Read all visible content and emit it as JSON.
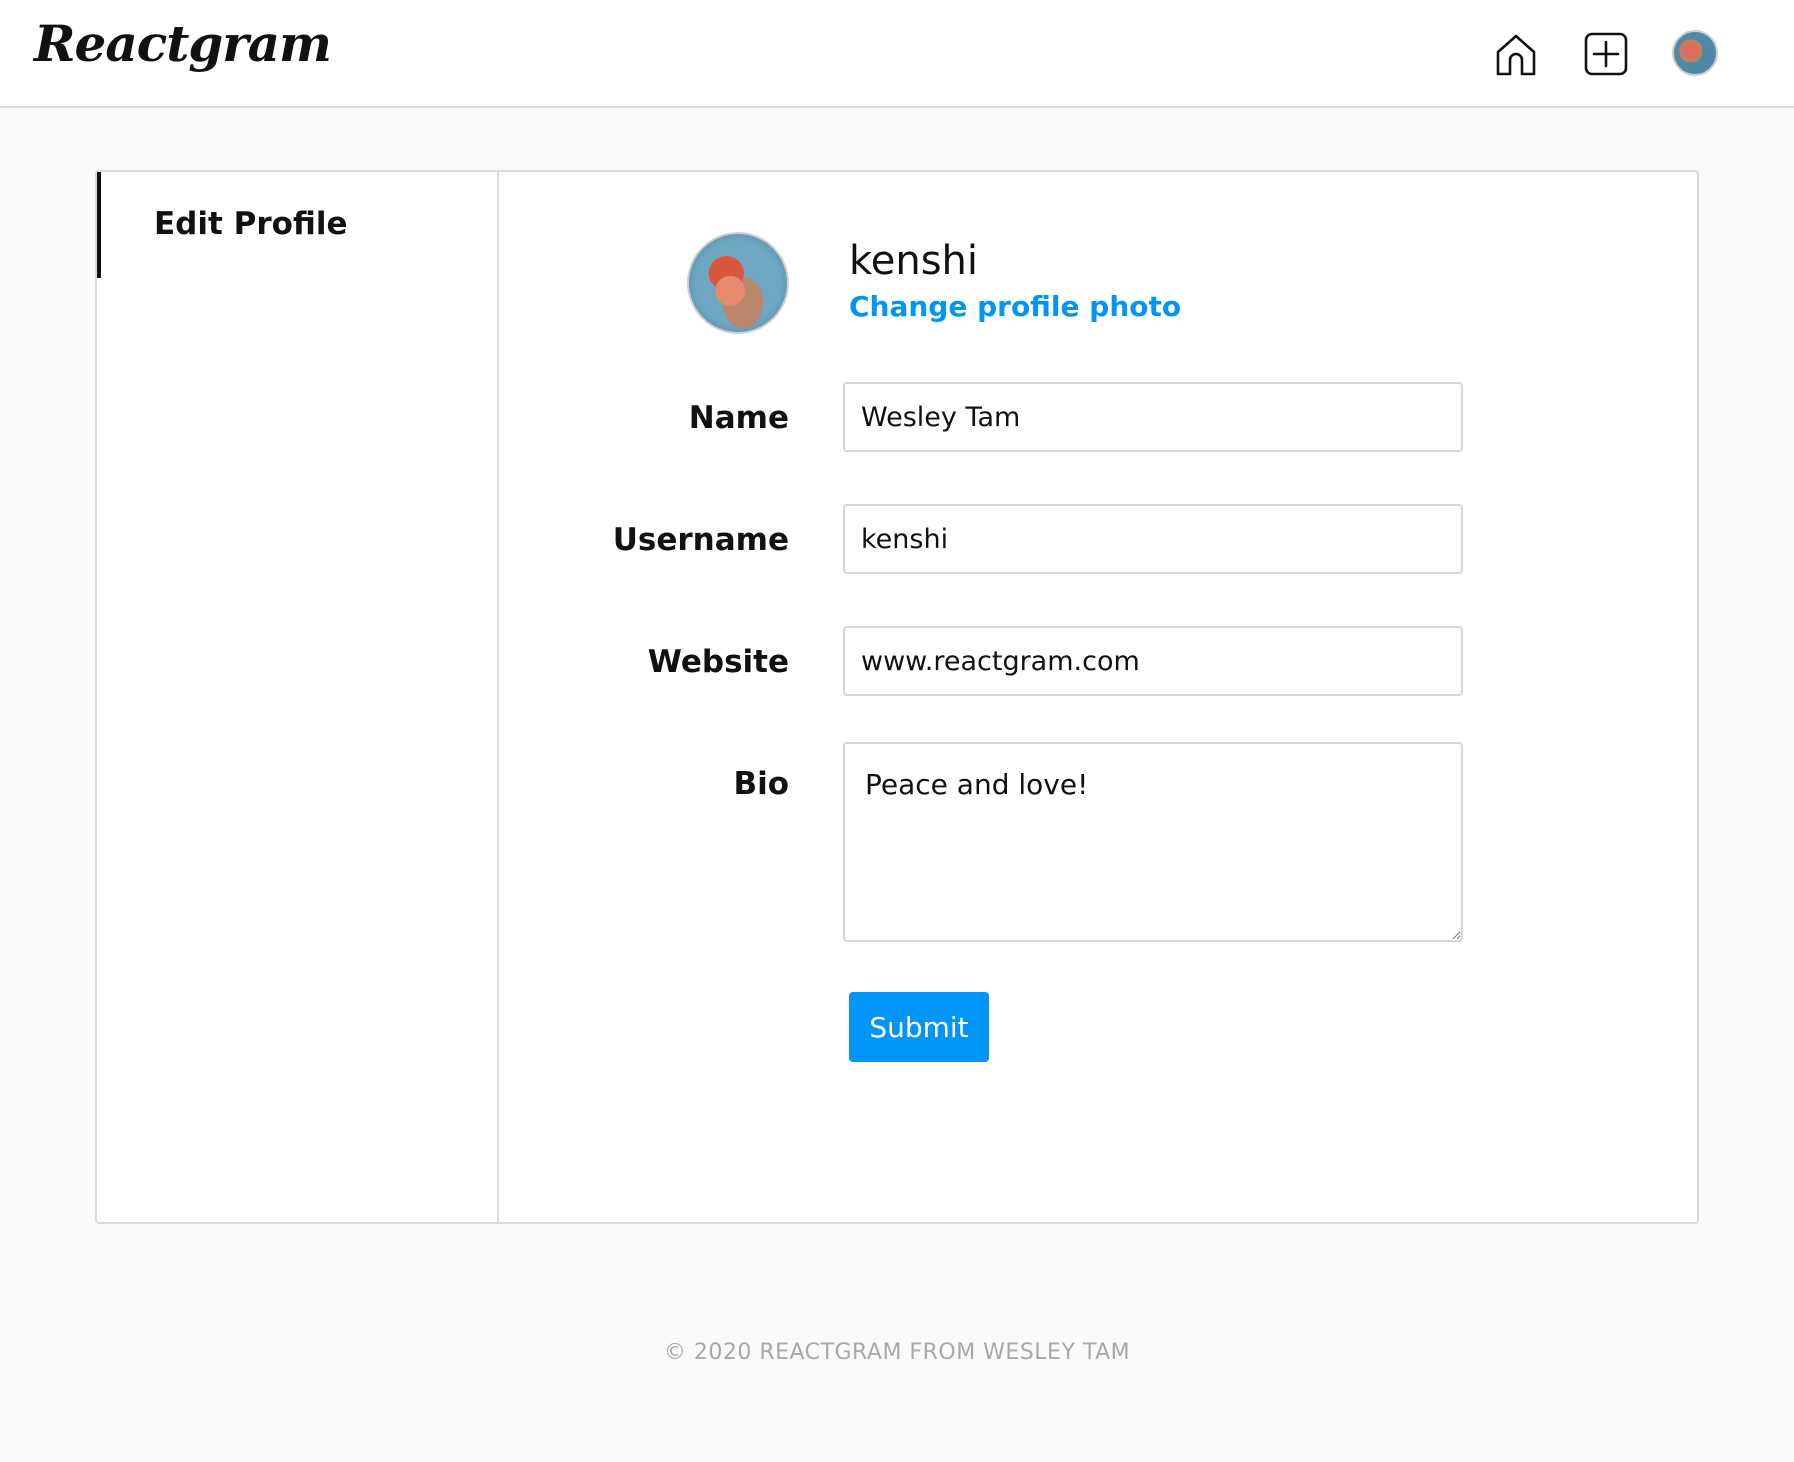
{
  "header": {
    "logo_text": "Reactgram",
    "icons": [
      "home-icon",
      "new-post-icon",
      "profile-avatar-icon"
    ]
  },
  "sidebar": {
    "items": [
      {
        "label": "Edit Profile",
        "active": true
      }
    ]
  },
  "profile": {
    "username": "kenshi",
    "change_photo_label": "Change profile photo"
  },
  "form": {
    "name": {
      "label": "Name",
      "value": "Wesley Tam"
    },
    "username": {
      "label": "Username",
      "value": "kenshi"
    },
    "website": {
      "label": "Website",
      "value": "www.reactgram.com"
    },
    "bio": {
      "label": "Bio",
      "value": "Peace and love!"
    },
    "submit_label": "Submit"
  },
  "footer": {
    "text": "© 2020 REACTGRAM FROM WESLEY TAM"
  },
  "colors": {
    "accent": "#0095f6",
    "border": "#dbdbdb",
    "background": "#fafafa"
  }
}
